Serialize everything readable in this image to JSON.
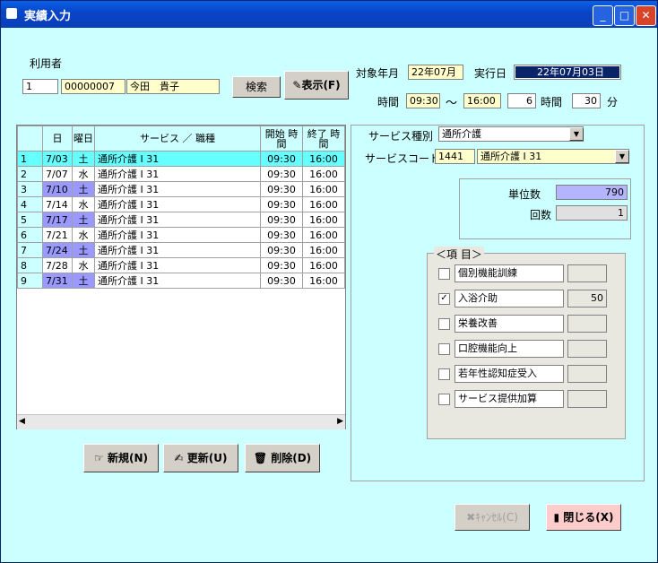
{
  "window": {
    "title": "実績入力",
    "controls": [
      "minimize-icon",
      "maximize-icon",
      "close-icon"
    ]
  },
  "user": {
    "label": "利用者",
    "no": "1",
    "code": "00000007",
    "name": "今田　貴子",
    "search_btn": "検索",
    "show_btn": "表示(F)"
  },
  "period": {
    "target_label": "対象年月",
    "target_value": "22年07月",
    "exec_label": "実行日",
    "exec_value": "22年07月03日"
  },
  "time": {
    "label": "時間",
    "start": "09:30",
    "tilde": "～",
    "end": "16:00",
    "hours": "6",
    "hours_unit": "時間",
    "minutes": "30",
    "minutes_unit": "分"
  },
  "table": {
    "headers": {
      "day": "日",
      "weekday": "曜日",
      "service": "サービス ／ 職種",
      "start": "開始 時間",
      "end": "終了 時間"
    },
    "rows": [
      {
        "n": "1",
        "day": "7/03",
        "wd": "土",
        "svc": "通所介護 I 31",
        "start": "09:30",
        "end": "16:00"
      },
      {
        "n": "2",
        "day": "7/07",
        "wd": "水",
        "svc": "通所介護 I 31",
        "start": "09:30",
        "end": "16:00"
      },
      {
        "n": "3",
        "day": "7/10",
        "wd": "土",
        "svc": "通所介護 I 31",
        "start": "09:30",
        "end": "16:00"
      },
      {
        "n": "4",
        "day": "7/14",
        "wd": "水",
        "svc": "通所介護 I 31",
        "start": "09:30",
        "end": "16:00"
      },
      {
        "n": "5",
        "day": "7/17",
        "wd": "土",
        "svc": "通所介護 I 31",
        "start": "09:30",
        "end": "16:00"
      },
      {
        "n": "6",
        "day": "7/21",
        "wd": "水",
        "svc": "通所介護 I 31",
        "start": "09:30",
        "end": "16:00"
      },
      {
        "n": "7",
        "day": "7/24",
        "wd": "土",
        "svc": "通所介護 I 31",
        "start": "09:30",
        "end": "16:00"
      },
      {
        "n": "8",
        "day": "7/28",
        "wd": "水",
        "svc": "通所介護 I 31",
        "start": "09:30",
        "end": "16:00"
      },
      {
        "n": "9",
        "day": "7/31",
        "wd": "土",
        "svc": "通所介護 I 31",
        "start": "09:30",
        "end": "16:00"
      }
    ]
  },
  "buttons": {
    "new": "新規(N)",
    "update": "更新(U)",
    "delete": "削除(D)",
    "cancel": "ｷｬﾝｾﾙ(C)",
    "close": "閉じる(X)"
  },
  "service": {
    "type_label": "サービス種別",
    "type_value": "通所介護",
    "code_label": "サービスコード",
    "code_value": "1441",
    "code_name": "通所介護 I 31"
  },
  "units": {
    "unit_label": "単位数",
    "unit_value": "790",
    "count_label": "回数",
    "count_value": "1"
  },
  "items": {
    "title": "＜項 目＞",
    "list": [
      {
        "label": "個別機能訓練",
        "checked": false,
        "value": ""
      },
      {
        "label": "入浴介助",
        "checked": true,
        "value": "50"
      },
      {
        "label": "栄養改善",
        "checked": false,
        "value": ""
      },
      {
        "label": "口腔機能向上",
        "checked": false,
        "value": ""
      },
      {
        "label": "若年性認知症受入",
        "checked": false,
        "value": ""
      },
      {
        "label": "サービス提供加算",
        "checked": false,
        "value": ""
      }
    ]
  },
  "colors": {
    "bg": "#ccffff",
    "input": "#ffffcc",
    "selected_row": "#66ffff",
    "saturday": "#9999ff"
  }
}
